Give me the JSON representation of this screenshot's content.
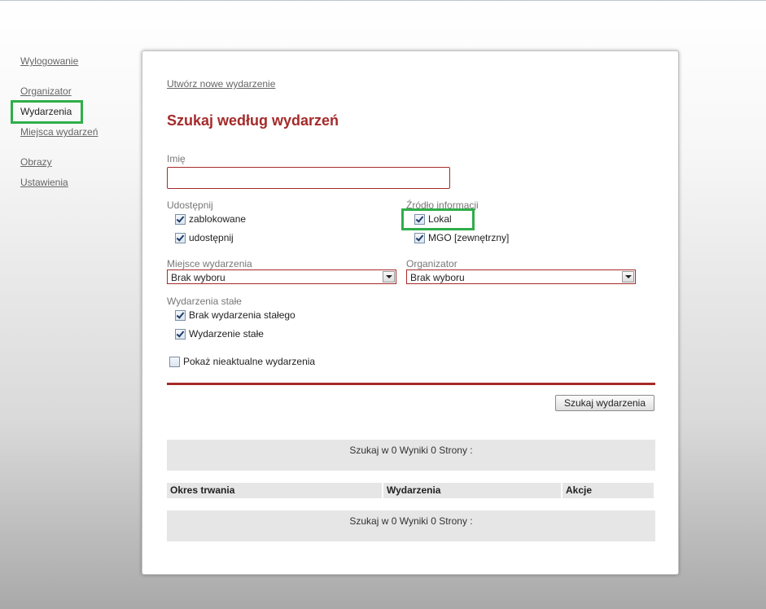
{
  "sidebar": {
    "logout": "Wylogowanie",
    "organizer": "Organizator",
    "events": "Wydarzenia",
    "venues": "Miejsca wydarzeń",
    "images": "Obrazy",
    "settings": "Ustawienia"
  },
  "main": {
    "create_link": "Utwórz nowe wydarzenie",
    "title": "Szukaj według wydarzeń",
    "name_label": "Imię",
    "name_value": "",
    "share": {
      "label": "Udostępnij",
      "blocked": "zablokowane",
      "shared": "udostępnij"
    },
    "source": {
      "label": "Źródło informacji",
      "local": "Lokal",
      "mgo": "MGO [zewnętrzny]"
    },
    "venue": {
      "label": "Miejsce wydarzenia",
      "value": "Brak wyboru"
    },
    "organizer_filter": {
      "label": "Organizator",
      "value": "Brak wyboru"
    },
    "permanent": {
      "label": "Wydarzenia stałe",
      "none": "Brak wydarzenia stałego",
      "permanent": "Wydarzenie stałe"
    },
    "show_outdated": "Pokaż nieaktualne wydarzenia",
    "search_button": "Szukaj wydarzenia",
    "results_top": "Szukaj w 0 Wyniki 0 Strony :",
    "table": {
      "col_duration": "Okres trwania",
      "col_events": "Wydarzenia",
      "col_actions": "Akcje"
    },
    "results_bottom": "Szukaj w 0 Wyniki 0 Strony :"
  },
  "colors": {
    "accent": "#a52a2a",
    "highlight": "#2fae4a"
  }
}
